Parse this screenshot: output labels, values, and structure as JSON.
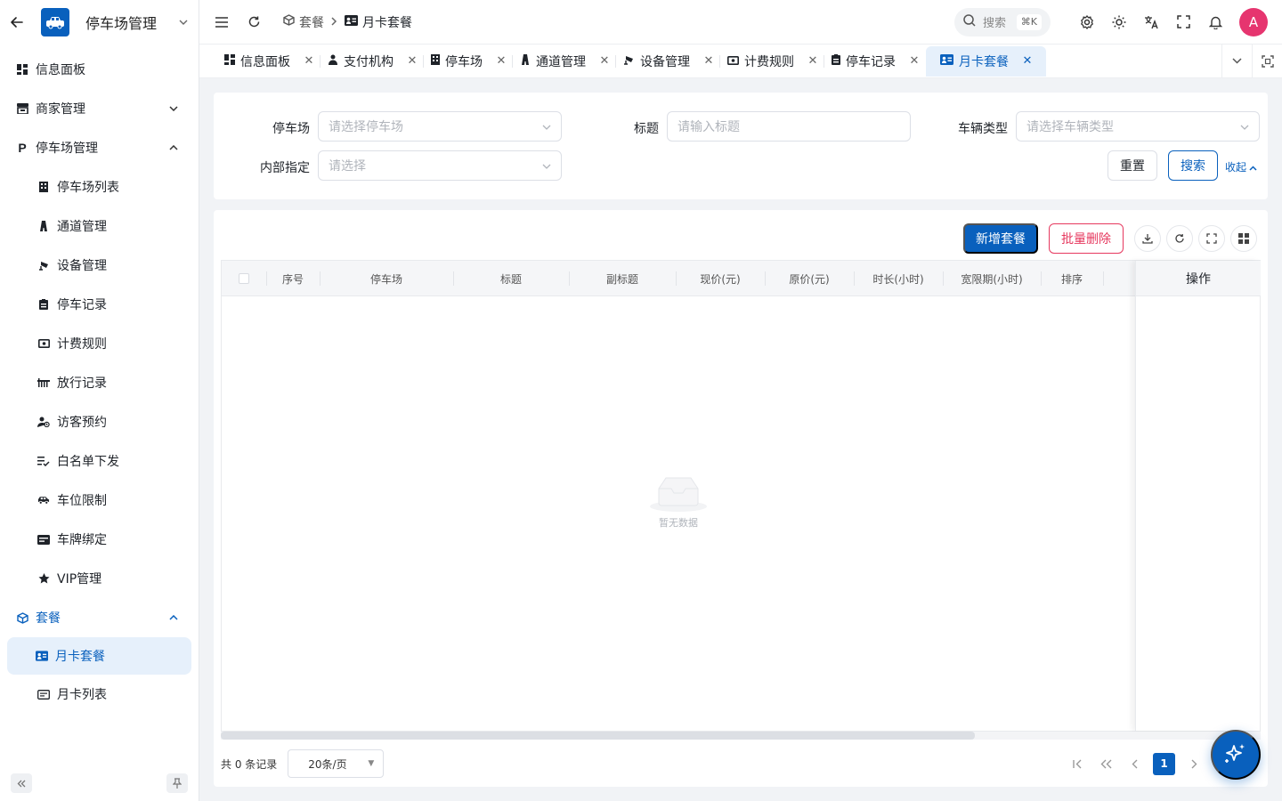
{
  "sidebar": {
    "title": "停车场管理",
    "menu": [
      {
        "label": "信息面板",
        "icon": "dashboard-icon"
      },
      {
        "label": "商家管理",
        "icon": "store-icon"
      },
      {
        "label": "停车场管理",
        "icon": "parking-icon"
      },
      {
        "label": "停车场列表",
        "icon": "building-icon"
      },
      {
        "label": "通道管理",
        "icon": "road-icon"
      },
      {
        "label": "设备管理",
        "icon": "camera-icon"
      },
      {
        "label": "停车记录",
        "icon": "clipboard-icon"
      },
      {
        "label": "计费规则",
        "icon": "money-icon"
      },
      {
        "label": "放行记录",
        "icon": "barrier-icon"
      },
      {
        "label": "访客预约",
        "icon": "visitor-icon"
      },
      {
        "label": "白名单下发",
        "icon": "list-check-icon"
      },
      {
        "label": "车位限制",
        "icon": "car-limit-icon"
      },
      {
        "label": "车牌绑定",
        "icon": "plate-icon"
      },
      {
        "label": "VIP管理",
        "icon": "star-icon"
      },
      {
        "label": "套餐",
        "icon": "package-icon"
      },
      {
        "label": "月卡套餐",
        "icon": "id-card-icon"
      },
      {
        "label": "月卡列表",
        "icon": "card-list-icon"
      }
    ]
  },
  "header": {
    "breadcrumb": [
      "套餐",
      "月卡套餐"
    ],
    "search_label": "搜索",
    "search_shortcut": "⌘K",
    "avatar_letter": "A"
  },
  "tabs": [
    {
      "label": "信息面板",
      "icon": "dashboard-icon"
    },
    {
      "label": "支付机构",
      "icon": "user-icon"
    },
    {
      "label": "停车场",
      "icon": "building-icon"
    },
    {
      "label": "通道管理",
      "icon": "road-icon"
    },
    {
      "label": "设备管理",
      "icon": "camera-icon"
    },
    {
      "label": "计费规则",
      "icon": "money-icon"
    },
    {
      "label": "停车记录",
      "icon": "clipboard-icon"
    },
    {
      "label": "月卡套餐",
      "icon": "id-card-icon",
      "active": true
    }
  ],
  "filter": {
    "parking_label": "停车场",
    "parking_placeholder": "请选择停车场",
    "title_label": "标题",
    "title_placeholder": "请输入标题",
    "vehicle_label": "车辆类型",
    "vehicle_placeholder": "请选择车辆类型",
    "internal_label": "内部指定",
    "internal_placeholder": "请选择",
    "reset_label": "重置",
    "search_label": "搜索",
    "collapse_label": "收起"
  },
  "toolbar": {
    "add_label": "新增套餐",
    "batch_delete_label": "批量删除"
  },
  "table": {
    "columns": [
      "序号",
      "停车场",
      "标题",
      "副标题",
      "现价(元)",
      "原价(元)",
      "时长(小时)",
      "宽限期(小时)",
      "排序"
    ],
    "action_column": "操作",
    "empty_text": "暂无数据",
    "rows": []
  },
  "pager": {
    "total_text": "共 0 条记录",
    "page_size": "20条/页",
    "current_page": "1"
  },
  "colors": {
    "primary": "#0960bd",
    "danger": "#e6385e",
    "avatar": "#e6356f"
  }
}
